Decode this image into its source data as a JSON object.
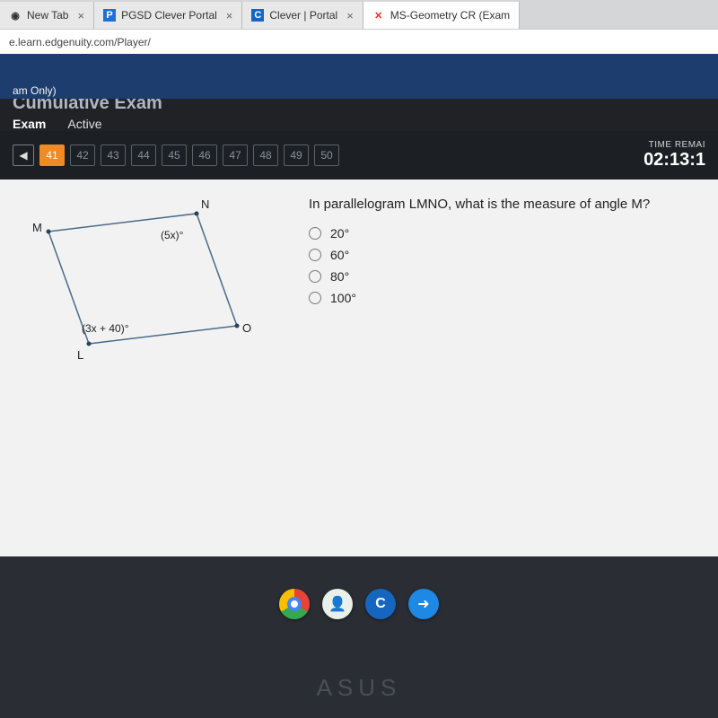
{
  "tabs": [
    {
      "icon": "◉",
      "label": "New Tab"
    },
    {
      "icon": "P",
      "label": "PGSD Clever Portal",
      "iconBg": "#1f6fd6",
      "iconColor": "#fff"
    },
    {
      "icon": "C",
      "label": "Clever | Portal",
      "iconBg": "#1566c0",
      "iconColor": "#fff"
    },
    {
      "icon": "✕",
      "label": "MS-Geometry CR (Exam",
      "iconColor": "#d32"
    }
  ],
  "address_bar": "e.learn.edgenuity.com/Player/",
  "header": {
    "banner": "am Only)"
  },
  "truncated_title": "Cumulative Exam",
  "exam_tabs": {
    "primary": "Exam",
    "secondary": "Active"
  },
  "question_nav": {
    "arrow": "◀",
    "current": "41",
    "rest": [
      "42",
      "43",
      "44",
      "45",
      "46",
      "47",
      "48",
      "49",
      "50"
    ]
  },
  "timer": {
    "label": "TIME REMAI",
    "value": "02:13:1"
  },
  "diagram": {
    "M": "M",
    "N": "N",
    "O": "O",
    "L": "L",
    "angle_N": "(5x)°",
    "angle_L": "(3x + 40)°"
  },
  "question": {
    "text": "In parallelogram LMNO, what is the measure of angle M?",
    "options": [
      "20°",
      "60°",
      "80°",
      "100°"
    ]
  },
  "dock": {
    "cleverLetter": "C",
    "arrow": "➜"
  },
  "brand": "ASUS"
}
